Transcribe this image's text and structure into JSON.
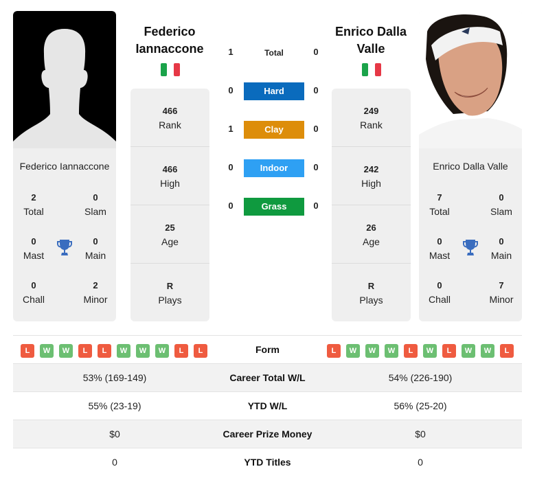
{
  "colors": {
    "hard": "#0a6bbd",
    "clay": "#dd8d0a",
    "indoor": "#2ea0f3",
    "grass": "#0f9a3f",
    "win": "#6cbf72",
    "loss": "#ef5b40",
    "trophy": "#3a6dbf"
  },
  "player1": {
    "name_header": "Federico Iannaccone",
    "card_name": "Federico Iannaccone",
    "flag": "italy-flag",
    "photo": "silhouette-placeholder",
    "titles": {
      "total": {
        "value": "2",
        "label": "Total"
      },
      "slam": {
        "value": "0",
        "label": "Slam"
      },
      "mast": {
        "value": "0",
        "label": "Mast"
      },
      "main": {
        "value": "0",
        "label": "Main"
      },
      "chall": {
        "value": "0",
        "label": "Chall"
      },
      "minor": {
        "value": "2",
        "label": "Minor"
      }
    },
    "stats": [
      {
        "value": "466",
        "label": "Rank"
      },
      {
        "value": "466",
        "label": "High"
      },
      {
        "value": "25",
        "label": "Age"
      },
      {
        "value": "R",
        "label": "Plays"
      }
    ],
    "form": [
      "L",
      "W",
      "W",
      "L",
      "L",
      "W",
      "W",
      "W",
      "L",
      "L"
    ],
    "career_total_wl": "53% (169-149)",
    "ytd_wl": "55% (23-19)",
    "career_prize_money": "$0",
    "ytd_titles": "0"
  },
  "player2": {
    "name_header": "Enrico Dalla Valle",
    "card_name": "Enrico Dalla Valle",
    "flag": "italy-flag",
    "photo": "player-photo",
    "titles": {
      "total": {
        "value": "7",
        "label": "Total"
      },
      "slam": {
        "value": "0",
        "label": "Slam"
      },
      "mast": {
        "value": "0",
        "label": "Mast"
      },
      "main": {
        "value": "0",
        "label": "Main"
      },
      "chall": {
        "value": "0",
        "label": "Chall"
      },
      "minor": {
        "value": "7",
        "label": "Minor"
      }
    },
    "stats": [
      {
        "value": "249",
        "label": "Rank"
      },
      {
        "value": "242",
        "label": "High"
      },
      {
        "value": "26",
        "label": "Age"
      },
      {
        "value": "R",
        "label": "Plays"
      }
    ],
    "form": [
      "L",
      "W",
      "W",
      "W",
      "L",
      "W",
      "L",
      "W",
      "W",
      "L"
    ],
    "career_total_wl": "54% (226-190)",
    "ytd_wl": "56% (25-20)",
    "career_prize_money": "$0",
    "ytd_titles": "0"
  },
  "h2h": [
    {
      "label": "Total",
      "p1": "1",
      "p2": "0",
      "type": "total"
    },
    {
      "label": "Hard",
      "p1": "0",
      "p2": "0",
      "type": "hard"
    },
    {
      "label": "Clay",
      "p1": "1",
      "p2": "0",
      "type": "clay"
    },
    {
      "label": "Indoor",
      "p1": "0",
      "p2": "0",
      "type": "indoor"
    },
    {
      "label": "Grass",
      "p1": "0",
      "p2": "0",
      "type": "grass"
    }
  ],
  "table_labels": {
    "form": "Form",
    "career_total_wl": "Career Total W/L",
    "ytd_wl": "YTD W/L",
    "career_prize_money": "Career Prize Money",
    "ytd_titles": "YTD Titles"
  }
}
